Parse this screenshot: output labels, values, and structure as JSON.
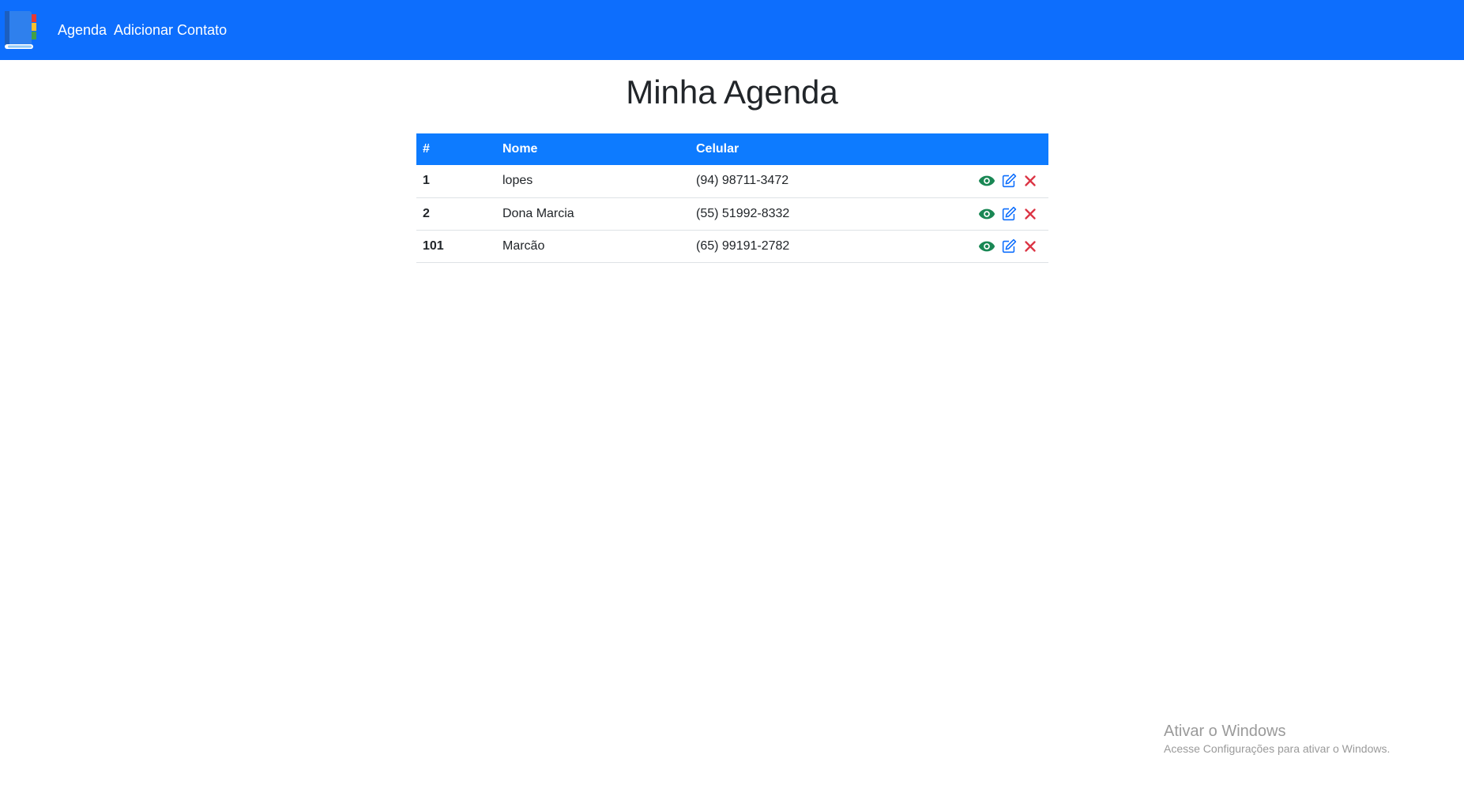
{
  "navbar": {
    "logo_icon": "address-book-icon",
    "links": [
      "Agenda",
      "Adicionar Contato"
    ],
    "background": "#0d6efd"
  },
  "page": {
    "title": "Minha Agenda"
  },
  "table": {
    "headers": [
      "#",
      "Nome",
      "Celular"
    ],
    "rows": [
      {
        "id": "1",
        "nome": "lopes",
        "celular": "(94) 98711-3472"
      },
      {
        "id": "2",
        "nome": "Dona Marcia",
        "celular": "(55) 51992-8332"
      },
      {
        "id": "101",
        "nome": "Marcão",
        "celular": "(65) 99191-2782"
      }
    ],
    "action_icons": [
      "eye-icon",
      "edit-icon",
      "close-icon"
    ],
    "action_colors": {
      "view": "#198754",
      "edit": "#0d6efd",
      "delete": "#dc3545"
    }
  },
  "watermark": {
    "title": "Ativar o Windows",
    "subtitle": "Acesse Configurações para ativar o Windows."
  }
}
